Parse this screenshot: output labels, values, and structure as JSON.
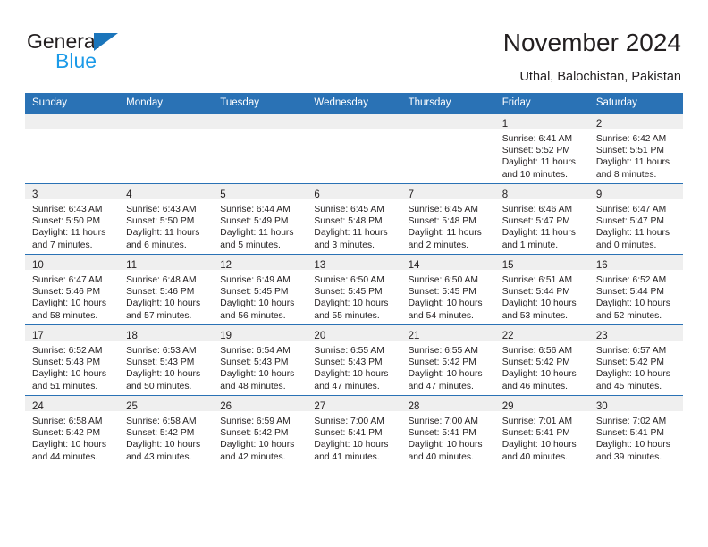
{
  "brand": {
    "name_part1": "General",
    "name_part2": "Blue",
    "triangle_color": "#1b75bb",
    "blue_text_color": "#1b9ae8"
  },
  "header": {
    "title": "November 2024",
    "subtitle": "Uthal, Balochistan, Pakistan",
    "header_bg_color": "#2a72b5",
    "daynum_band_color": "#efefef"
  },
  "weekdays": [
    "Sunday",
    "Monday",
    "Tuesday",
    "Wednesday",
    "Thursday",
    "Friday",
    "Saturday"
  ],
  "weeks": [
    [
      {
        "day": "",
        "empty": true,
        "sunrise": "",
        "sunset": "",
        "daylight_line1": "",
        "daylight_line2": ""
      },
      {
        "day": "",
        "empty": true,
        "sunrise": "",
        "sunset": "",
        "daylight_line1": "",
        "daylight_line2": ""
      },
      {
        "day": "",
        "empty": true,
        "sunrise": "",
        "sunset": "",
        "daylight_line1": "",
        "daylight_line2": ""
      },
      {
        "day": "",
        "empty": true,
        "sunrise": "",
        "sunset": "",
        "daylight_line1": "",
        "daylight_line2": ""
      },
      {
        "day": "",
        "empty": true,
        "sunrise": "",
        "sunset": "",
        "daylight_line1": "",
        "daylight_line2": ""
      },
      {
        "day": "1",
        "empty": false,
        "sunrise": "Sunrise: 6:41 AM",
        "sunset": "Sunset: 5:52 PM",
        "daylight_line1": "Daylight: 11 hours",
        "daylight_line2": "and 10 minutes."
      },
      {
        "day": "2",
        "empty": false,
        "sunrise": "Sunrise: 6:42 AM",
        "sunset": "Sunset: 5:51 PM",
        "daylight_line1": "Daylight: 11 hours",
        "daylight_line2": "and 8 minutes."
      }
    ],
    [
      {
        "day": "3",
        "empty": false,
        "sunrise": "Sunrise: 6:43 AM",
        "sunset": "Sunset: 5:50 PM",
        "daylight_line1": "Daylight: 11 hours",
        "daylight_line2": "and 7 minutes."
      },
      {
        "day": "4",
        "empty": false,
        "sunrise": "Sunrise: 6:43 AM",
        "sunset": "Sunset: 5:50 PM",
        "daylight_line1": "Daylight: 11 hours",
        "daylight_line2": "and 6 minutes."
      },
      {
        "day": "5",
        "empty": false,
        "sunrise": "Sunrise: 6:44 AM",
        "sunset": "Sunset: 5:49 PM",
        "daylight_line1": "Daylight: 11 hours",
        "daylight_line2": "and 5 minutes."
      },
      {
        "day": "6",
        "empty": false,
        "sunrise": "Sunrise: 6:45 AM",
        "sunset": "Sunset: 5:48 PM",
        "daylight_line1": "Daylight: 11 hours",
        "daylight_line2": "and 3 minutes."
      },
      {
        "day": "7",
        "empty": false,
        "sunrise": "Sunrise: 6:45 AM",
        "sunset": "Sunset: 5:48 PM",
        "daylight_line1": "Daylight: 11 hours",
        "daylight_line2": "and 2 minutes."
      },
      {
        "day": "8",
        "empty": false,
        "sunrise": "Sunrise: 6:46 AM",
        "sunset": "Sunset: 5:47 PM",
        "daylight_line1": "Daylight: 11 hours",
        "daylight_line2": "and 1 minute."
      },
      {
        "day": "9",
        "empty": false,
        "sunrise": "Sunrise: 6:47 AM",
        "sunset": "Sunset: 5:47 PM",
        "daylight_line1": "Daylight: 11 hours",
        "daylight_line2": "and 0 minutes."
      }
    ],
    [
      {
        "day": "10",
        "empty": false,
        "sunrise": "Sunrise: 6:47 AM",
        "sunset": "Sunset: 5:46 PM",
        "daylight_line1": "Daylight: 10 hours",
        "daylight_line2": "and 58 minutes."
      },
      {
        "day": "11",
        "empty": false,
        "sunrise": "Sunrise: 6:48 AM",
        "sunset": "Sunset: 5:46 PM",
        "daylight_line1": "Daylight: 10 hours",
        "daylight_line2": "and 57 minutes."
      },
      {
        "day": "12",
        "empty": false,
        "sunrise": "Sunrise: 6:49 AM",
        "sunset": "Sunset: 5:45 PM",
        "daylight_line1": "Daylight: 10 hours",
        "daylight_line2": "and 56 minutes."
      },
      {
        "day": "13",
        "empty": false,
        "sunrise": "Sunrise: 6:50 AM",
        "sunset": "Sunset: 5:45 PM",
        "daylight_line1": "Daylight: 10 hours",
        "daylight_line2": "and 55 minutes."
      },
      {
        "day": "14",
        "empty": false,
        "sunrise": "Sunrise: 6:50 AM",
        "sunset": "Sunset: 5:45 PM",
        "daylight_line1": "Daylight: 10 hours",
        "daylight_line2": "and 54 minutes."
      },
      {
        "day": "15",
        "empty": false,
        "sunrise": "Sunrise: 6:51 AM",
        "sunset": "Sunset: 5:44 PM",
        "daylight_line1": "Daylight: 10 hours",
        "daylight_line2": "and 53 minutes."
      },
      {
        "day": "16",
        "empty": false,
        "sunrise": "Sunrise: 6:52 AM",
        "sunset": "Sunset: 5:44 PM",
        "daylight_line1": "Daylight: 10 hours",
        "daylight_line2": "and 52 minutes."
      }
    ],
    [
      {
        "day": "17",
        "empty": false,
        "sunrise": "Sunrise: 6:52 AM",
        "sunset": "Sunset: 5:43 PM",
        "daylight_line1": "Daylight: 10 hours",
        "daylight_line2": "and 51 minutes."
      },
      {
        "day": "18",
        "empty": false,
        "sunrise": "Sunrise: 6:53 AM",
        "sunset": "Sunset: 5:43 PM",
        "daylight_line1": "Daylight: 10 hours",
        "daylight_line2": "and 50 minutes."
      },
      {
        "day": "19",
        "empty": false,
        "sunrise": "Sunrise: 6:54 AM",
        "sunset": "Sunset: 5:43 PM",
        "daylight_line1": "Daylight: 10 hours",
        "daylight_line2": "and 48 minutes."
      },
      {
        "day": "20",
        "empty": false,
        "sunrise": "Sunrise: 6:55 AM",
        "sunset": "Sunset: 5:43 PM",
        "daylight_line1": "Daylight: 10 hours",
        "daylight_line2": "and 47 minutes."
      },
      {
        "day": "21",
        "empty": false,
        "sunrise": "Sunrise: 6:55 AM",
        "sunset": "Sunset: 5:42 PM",
        "daylight_line1": "Daylight: 10 hours",
        "daylight_line2": "and 47 minutes."
      },
      {
        "day": "22",
        "empty": false,
        "sunrise": "Sunrise: 6:56 AM",
        "sunset": "Sunset: 5:42 PM",
        "daylight_line1": "Daylight: 10 hours",
        "daylight_line2": "and 46 minutes."
      },
      {
        "day": "23",
        "empty": false,
        "sunrise": "Sunrise: 6:57 AM",
        "sunset": "Sunset: 5:42 PM",
        "daylight_line1": "Daylight: 10 hours",
        "daylight_line2": "and 45 minutes."
      }
    ],
    [
      {
        "day": "24",
        "empty": false,
        "sunrise": "Sunrise: 6:58 AM",
        "sunset": "Sunset: 5:42 PM",
        "daylight_line1": "Daylight: 10 hours",
        "daylight_line2": "and 44 minutes."
      },
      {
        "day": "25",
        "empty": false,
        "sunrise": "Sunrise: 6:58 AM",
        "sunset": "Sunset: 5:42 PM",
        "daylight_line1": "Daylight: 10 hours",
        "daylight_line2": "and 43 minutes."
      },
      {
        "day": "26",
        "empty": false,
        "sunrise": "Sunrise: 6:59 AM",
        "sunset": "Sunset: 5:42 PM",
        "daylight_line1": "Daylight: 10 hours",
        "daylight_line2": "and 42 minutes."
      },
      {
        "day": "27",
        "empty": false,
        "sunrise": "Sunrise: 7:00 AM",
        "sunset": "Sunset: 5:41 PM",
        "daylight_line1": "Daylight: 10 hours",
        "daylight_line2": "and 41 minutes."
      },
      {
        "day": "28",
        "empty": false,
        "sunrise": "Sunrise: 7:00 AM",
        "sunset": "Sunset: 5:41 PM",
        "daylight_line1": "Daylight: 10 hours",
        "daylight_line2": "and 40 minutes."
      },
      {
        "day": "29",
        "empty": false,
        "sunrise": "Sunrise: 7:01 AM",
        "sunset": "Sunset: 5:41 PM",
        "daylight_line1": "Daylight: 10 hours",
        "daylight_line2": "and 40 minutes."
      },
      {
        "day": "30",
        "empty": false,
        "sunrise": "Sunrise: 7:02 AM",
        "sunset": "Sunset: 5:41 PM",
        "daylight_line1": "Daylight: 10 hours",
        "daylight_line2": "and 39 minutes."
      }
    ]
  ]
}
